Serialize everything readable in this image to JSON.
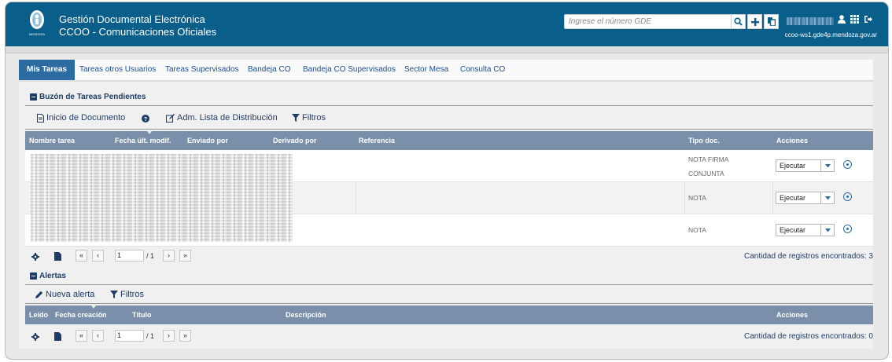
{
  "header": {
    "title": "Gestión Documental Electrónica",
    "subtitle": "CCOO - Comunicaciones Oficiales",
    "search_placeholder": "Ingrese el número GDE",
    "server": "ccoo-ws1.gde4p.mendoza.gov.ar",
    "logo_text": "MENDOZA"
  },
  "tabs": [
    "Mis Tareas",
    "Tareas otros Usuarios",
    "Tareas Supervisados",
    "Bandeja CO",
    "Bandeja CO Supervisados",
    "Sector Mesa",
    "Consulta CO"
  ],
  "tasks": {
    "title": "Buzón de Tareas Pendientes",
    "toolbar": {
      "inicio": "Inicio de Documento",
      "adm": "Adm. Lista de Distribución",
      "filtros": "Filtros"
    },
    "columns": [
      "Nombre tarea",
      "Fecha últ. modif.",
      "Enviado por",
      "Derivado por",
      "Referencia",
      "Tipo doc.",
      "Acciones"
    ],
    "rows": [
      {
        "tipo1": "NOTA FIRMA",
        "tipo2": "CONJUNTA",
        "accion": "Ejecutar"
      },
      {
        "tipo1": "NOTA",
        "tipo2": "",
        "accion": "Ejecutar"
      },
      {
        "tipo1": "NOTA",
        "tipo2": "",
        "accion": "Ejecutar"
      }
    ],
    "pager": {
      "page": "1",
      "total": "/ 1",
      "count": "Cantidad de registros encontrados: 3"
    }
  },
  "alerts": {
    "title": "Alertas",
    "toolbar": {
      "nueva": "Nueva alerta",
      "filtros": "Filtros"
    },
    "columns": [
      "Leído",
      "Fecha creación",
      "Título",
      "Descripción",
      "Acciones"
    ],
    "pager": {
      "page": "1",
      "total": "/ 1",
      "count": "Cantidad de registros encontrados: 0"
    }
  },
  "colors": {
    "header": "#0a5e8a",
    "accent": "#2d6ca2",
    "table_header": "#7a8fa9"
  }
}
